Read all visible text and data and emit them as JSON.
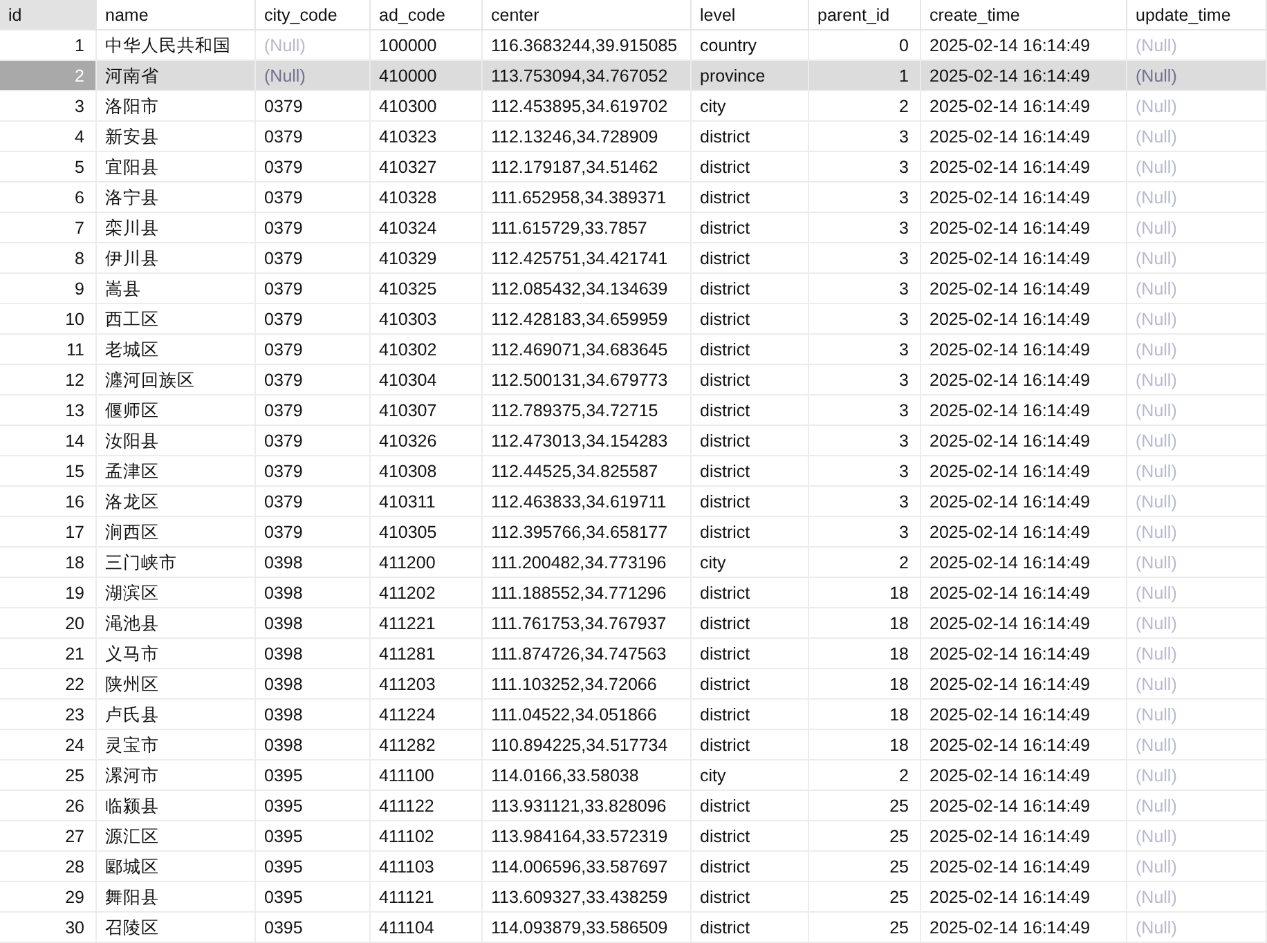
{
  "table": {
    "columns": [
      {
        "label": "id"
      },
      {
        "label": "name"
      },
      {
        "label": "city_code"
      },
      {
        "label": "ad_code"
      },
      {
        "label": "center"
      },
      {
        "label": "level"
      },
      {
        "label": "parent_id"
      },
      {
        "label": "create_time"
      },
      {
        "label": "update_time"
      }
    ],
    "rows": [
      {
        "selected": false,
        "cells": [
          "1",
          "中华人民共和国",
          {
            "kind": "null",
            "text": "(Null)"
          },
          "100000",
          "116.3683244,39.915085",
          "country",
          "0",
          "2025-02-14 16:14:49",
          {
            "kind": "null",
            "text": "(Null)"
          }
        ]
      },
      {
        "selected": true,
        "cells": [
          "2",
          "河南省",
          {
            "kind": "null",
            "text": "(Null)"
          },
          "410000",
          "113.753094,34.767052",
          "province",
          "1",
          "2025-02-14 16:14:49",
          {
            "kind": "null",
            "text": "(Null)"
          }
        ]
      },
      {
        "selected": false,
        "cells": [
          "3",
          "洛阳市",
          "0379",
          "410300",
          "112.453895,34.619702",
          "city",
          "2",
          "2025-02-14 16:14:49",
          {
            "kind": "null",
            "text": "(Null)"
          }
        ]
      },
      {
        "selected": false,
        "cells": [
          "4",
          "新安县",
          "0379",
          "410323",
          "112.13246,34.728909",
          "district",
          "3",
          "2025-02-14 16:14:49",
          {
            "kind": "null",
            "text": "(Null)"
          }
        ]
      },
      {
        "selected": false,
        "cells": [
          "5",
          "宜阳县",
          "0379",
          "410327",
          "112.179187,34.51462",
          "district",
          "3",
          "2025-02-14 16:14:49",
          {
            "kind": "null",
            "text": "(Null)"
          }
        ]
      },
      {
        "selected": false,
        "cells": [
          "6",
          "洛宁县",
          "0379",
          "410328",
          "111.652958,34.389371",
          "district",
          "3",
          "2025-02-14 16:14:49",
          {
            "kind": "null",
            "text": "(Null)"
          }
        ]
      },
      {
        "selected": false,
        "cells": [
          "7",
          "栾川县",
          "0379",
          "410324",
          "111.615729,33.7857",
          "district",
          "3",
          "2025-02-14 16:14:49",
          {
            "kind": "null",
            "text": "(Null)"
          }
        ]
      },
      {
        "selected": false,
        "cells": [
          "8",
          "伊川县",
          "0379",
          "410329",
          "112.425751,34.421741",
          "district",
          "3",
          "2025-02-14 16:14:49",
          {
            "kind": "null",
            "text": "(Null)"
          }
        ]
      },
      {
        "selected": false,
        "cells": [
          "9",
          "嵩县",
          "0379",
          "410325",
          "112.085432,34.134639",
          "district",
          "3",
          "2025-02-14 16:14:49",
          {
            "kind": "null",
            "text": "(Null)"
          }
        ]
      },
      {
        "selected": false,
        "cells": [
          "10",
          "西工区",
          "0379",
          "410303",
          "112.428183,34.659959",
          "district",
          "3",
          "2025-02-14 16:14:49",
          {
            "kind": "null",
            "text": "(Null)"
          }
        ]
      },
      {
        "selected": false,
        "cells": [
          "11",
          "老城区",
          "0379",
          "410302",
          "112.469071,34.683645",
          "district",
          "3",
          "2025-02-14 16:14:49",
          {
            "kind": "null",
            "text": "(Null)"
          }
        ]
      },
      {
        "selected": false,
        "cells": [
          "12",
          "瀍河回族区",
          "0379",
          "410304",
          "112.500131,34.679773",
          "district",
          "3",
          "2025-02-14 16:14:49",
          {
            "kind": "null",
            "text": "(Null)"
          }
        ]
      },
      {
        "selected": false,
        "cells": [
          "13",
          "偃师区",
          "0379",
          "410307",
          "112.789375,34.72715",
          "district",
          "3",
          "2025-02-14 16:14:49",
          {
            "kind": "null",
            "text": "(Null)"
          }
        ]
      },
      {
        "selected": false,
        "cells": [
          "14",
          "汝阳县",
          "0379",
          "410326",
          "112.473013,34.154283",
          "district",
          "3",
          "2025-02-14 16:14:49",
          {
            "kind": "null",
            "text": "(Null)"
          }
        ]
      },
      {
        "selected": false,
        "cells": [
          "15",
          "孟津区",
          "0379",
          "410308",
          "112.44525,34.825587",
          "district",
          "3",
          "2025-02-14 16:14:49",
          {
            "kind": "null",
            "text": "(Null)"
          }
        ]
      },
      {
        "selected": false,
        "cells": [
          "16",
          "洛龙区",
          "0379",
          "410311",
          "112.463833,34.619711",
          "district",
          "3",
          "2025-02-14 16:14:49",
          {
            "kind": "null",
            "text": "(Null)"
          }
        ]
      },
      {
        "selected": false,
        "cells": [
          "17",
          "涧西区",
          "0379",
          "410305",
          "112.395766,34.658177",
          "district",
          "3",
          "2025-02-14 16:14:49",
          {
            "kind": "null",
            "text": "(Null)"
          }
        ]
      },
      {
        "selected": false,
        "cells": [
          "18",
          "三门峡市",
          "0398",
          "411200",
          "111.200482,34.773196",
          "city",
          "2",
          "2025-02-14 16:14:49",
          {
            "kind": "null",
            "text": "(Null)"
          }
        ]
      },
      {
        "selected": false,
        "cells": [
          "19",
          "湖滨区",
          "0398",
          "411202",
          "111.188552,34.771296",
          "district",
          "18",
          "2025-02-14 16:14:49",
          {
            "kind": "null",
            "text": "(Null)"
          }
        ]
      },
      {
        "selected": false,
        "cells": [
          "20",
          "渑池县",
          "0398",
          "411221",
          "111.761753,34.767937",
          "district",
          "18",
          "2025-02-14 16:14:49",
          {
            "kind": "null",
            "text": "(Null)"
          }
        ]
      },
      {
        "selected": false,
        "cells": [
          "21",
          "义马市",
          "0398",
          "411281",
          "111.874726,34.747563",
          "district",
          "18",
          "2025-02-14 16:14:49",
          {
            "kind": "null",
            "text": "(Null)"
          }
        ]
      },
      {
        "selected": false,
        "cells": [
          "22",
          "陕州区",
          "0398",
          "411203",
          "111.103252,34.72066",
          "district",
          "18",
          "2025-02-14 16:14:49",
          {
            "kind": "null",
            "text": "(Null)"
          }
        ]
      },
      {
        "selected": false,
        "cells": [
          "23",
          "卢氏县",
          "0398",
          "411224",
          "111.04522,34.051866",
          "district",
          "18",
          "2025-02-14 16:14:49",
          {
            "kind": "null",
            "text": "(Null)"
          }
        ]
      },
      {
        "selected": false,
        "cells": [
          "24",
          "灵宝市",
          "0398",
          "411282",
          "110.894225,34.517734",
          "district",
          "18",
          "2025-02-14 16:14:49",
          {
            "kind": "null",
            "text": "(Null)"
          }
        ]
      },
      {
        "selected": false,
        "cells": [
          "25",
          "漯河市",
          "0395",
          "411100",
          "114.0166,33.58038",
          "city",
          "2",
          "2025-02-14 16:14:49",
          {
            "kind": "null",
            "text": "(Null)"
          }
        ]
      },
      {
        "selected": false,
        "cells": [
          "26",
          "临颍县",
          "0395",
          "411122",
          "113.931121,33.828096",
          "district",
          "25",
          "2025-02-14 16:14:49",
          {
            "kind": "null",
            "text": "(Null)"
          }
        ]
      },
      {
        "selected": false,
        "cells": [
          "27",
          "源汇区",
          "0395",
          "411102",
          "113.984164,33.572319",
          "district",
          "25",
          "2025-02-14 16:14:49",
          {
            "kind": "null",
            "text": "(Null)"
          }
        ]
      },
      {
        "selected": false,
        "cells": [
          "28",
          "郾城区",
          "0395",
          "411103",
          "114.006596,33.587697",
          "district",
          "25",
          "2025-02-14 16:14:49",
          {
            "kind": "null",
            "text": "(Null)"
          }
        ]
      },
      {
        "selected": false,
        "cells": [
          "29",
          "舞阳县",
          "0395",
          "411121",
          "113.609327,33.438259",
          "district",
          "25",
          "2025-02-14 16:14:49",
          {
            "kind": "null",
            "text": "(Null)"
          }
        ]
      },
      {
        "selected": false,
        "cells": [
          "30",
          "召陵区",
          "0395",
          "411104",
          "114.093879,33.586509",
          "district",
          "25",
          "2025-02-14 16:14:49",
          {
            "kind": "null",
            "text": "(Null)"
          }
        ]
      }
    ]
  }
}
